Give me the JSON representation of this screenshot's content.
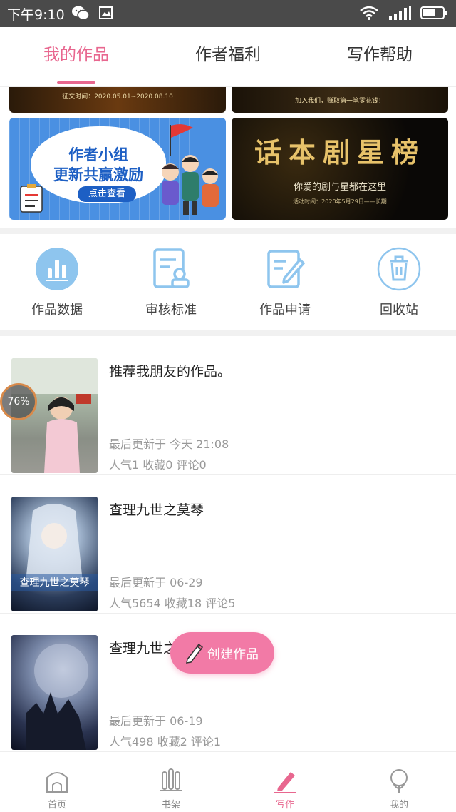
{
  "status_bar": {
    "time": "下午9:10"
  },
  "tabs": [
    {
      "label": "我的作品",
      "active": true
    },
    {
      "label": "作者福利",
      "active": false
    },
    {
      "label": "写作帮助",
      "active": false
    }
  ],
  "banners": {
    "top_left_text": "征文时间：2020.05.01~2020.08.10",
    "top_right_text": "加入我们，赚取第一笔零花钱！",
    "author_group": {
      "line1": "作者小组",
      "line2": "更新共赢激励",
      "button": "点击查看"
    },
    "star_list": {
      "title": "话本剧星榜",
      "subtitle": "你爱的剧与星都在这里",
      "date": "活动时间：2020年5月29日——长期"
    }
  },
  "quick_actions": [
    {
      "label": "作品数据",
      "icon": "bar-chart-icon"
    },
    {
      "label": "审核标准",
      "icon": "review-standard-icon"
    },
    {
      "label": "作品申请",
      "icon": "edit-apply-icon"
    },
    {
      "label": "回收站",
      "icon": "trash-icon"
    }
  ],
  "works": [
    {
      "title": "推荐我朋友的作品。",
      "updated": "最后更新于 今天 21:08",
      "stats": "人气1  收藏0  评论0"
    },
    {
      "title": "查理九世之莫琴",
      "updated": "最后更新于 06-29",
      "stats": "人气5654  收藏18  评论5",
      "cover_label": "查理九世之莫琴"
    },
    {
      "title": "查理九世之",
      "updated": "最后更新于 06-19",
      "stats": "人气498  收藏2  评论1"
    }
  ],
  "progress_badge": "76%",
  "fab_label": "创建作品",
  "bottom_nav": [
    {
      "label": "首页",
      "icon": "home-icon",
      "active": false
    },
    {
      "label": "书架",
      "icon": "bookshelf-icon",
      "active": false
    },
    {
      "label": "写作",
      "icon": "pen-icon",
      "active": true
    },
    {
      "label": "我的",
      "icon": "profile-icon",
      "active": false
    }
  ],
  "colors": {
    "accent": "#e8678f",
    "fab": "#f27aa6",
    "action_icon": "#8ec5ee"
  }
}
